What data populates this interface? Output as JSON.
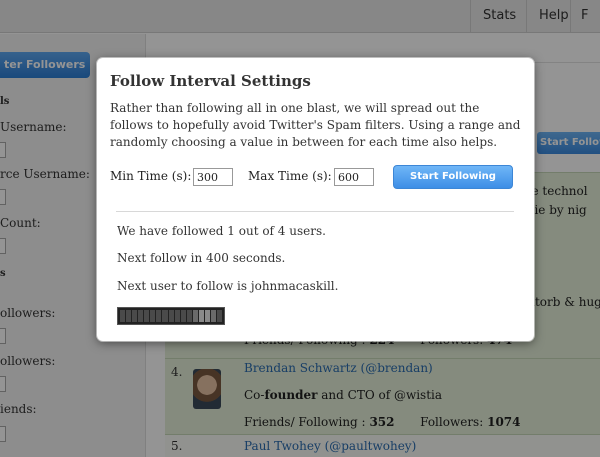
{
  "nav": {
    "tabs": [
      "Stats",
      "Help",
      "F"
    ]
  },
  "sidebar": {
    "button_label": "ter Followers",
    "labels": [
      {
        "text": "ls",
        "bold": true
      },
      {
        "text": "Username:",
        "bold": false
      },
      {
        "text": "rce Username:",
        "bold": false
      },
      {
        "text": "Count:",
        "bold": false
      },
      {
        "text": "s",
        "bold": true
      },
      {
        "text": "ollowers:",
        "bold": false
      },
      {
        "text": "ollowers:",
        "bold": false
      },
      {
        "text": "iends:",
        "bold": false
      }
    ]
  },
  "main": {
    "start_button_label": "Start Follow",
    "fragments": {
      "bio_a": "ble technol",
      "bio_b": "chie by nig",
      "bio_c": "ontorb & hug",
      "friends_label": "Friends/ Following :",
      "followers_label": "Followers:"
    },
    "users": [
      {
        "number": "",
        "name": "",
        "bio": "",
        "friends": "224",
        "followers": "474"
      },
      {
        "number": "4.",
        "name": "Brendan Schwartz (@brendan)",
        "bio_pre": "Co-",
        "bio_bold": "founder",
        "bio_post": " and CTO of @wistia",
        "friends": "352",
        "followers": "1074"
      },
      {
        "number": "5.",
        "name": "Paul Twohey (@paultwohey)"
      }
    ]
  },
  "modal": {
    "title": "Follow Interval Settings",
    "description": "Rather than following all in one blast, we will spread out the follows to hopefully avoid Twitter's Spam filters. Using a range and randomly choosing a value in between for each time also helps.",
    "min_label": "Min Time (s):",
    "min_value": "300",
    "max_label": "Max Time (s):",
    "max_value": "600",
    "start_button": "Start Following",
    "status_followed": "We have followed 1 out of 4 users.",
    "status_next_follow": "Next follow in 400 seconds.",
    "status_next_user": "Next user to follow is johnmacaskill.",
    "progress_fraction": 0.25
  },
  "colors": {
    "accent": "#3d8ee6",
    "row_green": "#e5f0d9",
    "link": "#2a6bb0"
  }
}
